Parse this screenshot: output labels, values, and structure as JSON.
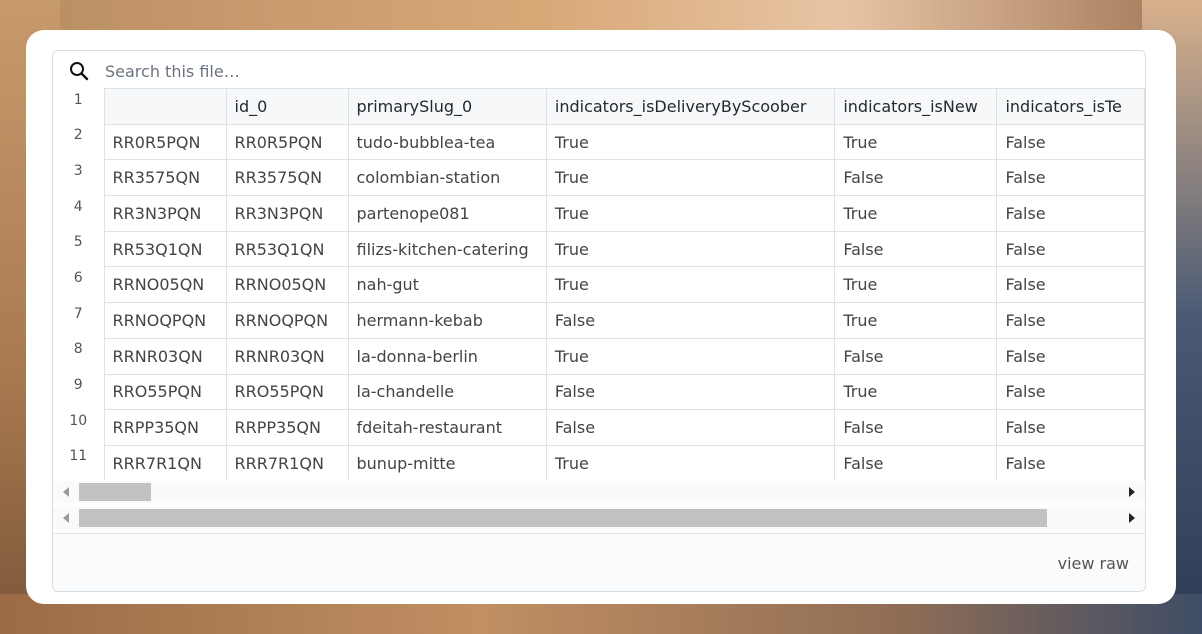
{
  "search": {
    "placeholder": "Search this file…"
  },
  "table": {
    "header_line_number": "1",
    "columns": [
      "",
      "id_0",
      "primarySlug_0",
      "indicators_isDeliveryByScoober",
      "indicators_isNew",
      "indicators_isTe"
    ],
    "rows": [
      {
        "ln": "2",
        "cells": [
          "RR0R5PQN",
          "RR0R5PQN",
          "tudo-bubblea-tea",
          "True",
          "True",
          "False"
        ]
      },
      {
        "ln": "3",
        "cells": [
          "RR3575QN",
          "RR3575QN",
          "colombian-station",
          "True",
          "False",
          "False"
        ]
      },
      {
        "ln": "4",
        "cells": [
          "RR3N3PQN",
          "RR3N3PQN",
          "partenope081",
          "True",
          "True",
          "False"
        ]
      },
      {
        "ln": "5",
        "cells": [
          "RR53Q1QN",
          "RR53Q1QN",
          "filizs-kitchen-catering",
          "True",
          "False",
          "False"
        ]
      },
      {
        "ln": "6",
        "cells": [
          "RRNO05QN",
          "RRNO05QN",
          "nah-gut",
          "True",
          "True",
          "False"
        ]
      },
      {
        "ln": "7",
        "cells": [
          "RRNOQPQN",
          "RRNOQPQN",
          "hermann-kebab",
          "False",
          "True",
          "False"
        ]
      },
      {
        "ln": "8",
        "cells": [
          "RRNR03QN",
          "RRNR03QN",
          "la-donna-berlin",
          "True",
          "False",
          "False"
        ]
      },
      {
        "ln": "9",
        "cells": [
          "RRO55PQN",
          "RRO55PQN",
          "la-chandelle",
          "False",
          "True",
          "False"
        ]
      },
      {
        "ln": "10",
        "cells": [
          "RRPP35QN",
          "RRPP35QN",
          "fdeitah-restaurant",
          "False",
          "False",
          "False"
        ]
      },
      {
        "ln": "11",
        "cells": [
          "RRR7R1QN",
          "RRR7R1QN",
          "bunup-mitte",
          "True",
          "False",
          "False"
        ]
      }
    ]
  },
  "footer": {
    "view_raw": "view raw"
  },
  "icons": {
    "search": "search-icon",
    "scroll_left": "arrow-left-icon",
    "scroll_right": "arrow-right-icon"
  }
}
